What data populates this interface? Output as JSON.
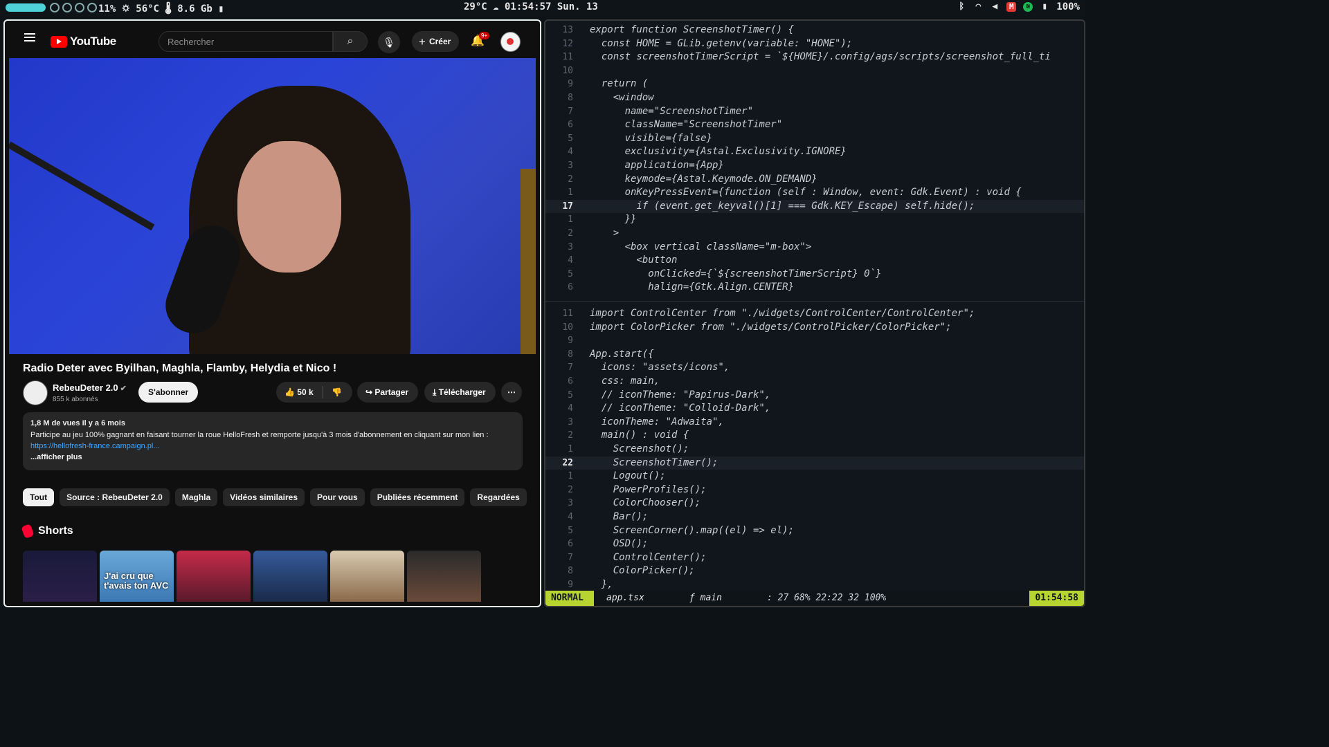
{
  "topbar": {
    "stats": "11% 🌣 56°C 🌡 8.6 Gb ▮",
    "weather_clock": "29°C ☁   01:54:57   Sun. 13",
    "battery": "100%",
    "icons": [
      "bluetooth-icon",
      "wifi-icon",
      "volume-icon",
      "mail-icon",
      "spotify-icon",
      "battery-icon"
    ]
  },
  "youtube": {
    "logo_text": "YouTube",
    "search_placeholder": "Rechercher",
    "create_label": "Créer",
    "notif_badge": "9+",
    "video_title": "Radio Deter avec Byilhan, Maghla, Flamby, Helydia et Nico !",
    "channel_name": "RebeuDeter 2.0",
    "subscribers": "855 k abonnés",
    "subscribe_label": "S'abonner",
    "likes": "50 k",
    "share_label": "Partager",
    "download_label": "Télécharger",
    "desc_meta": "1,8 M de vues  il y a 6 mois",
    "desc_text": "Participe au jeu 100% gagnant en faisant tourner la roue HelloFresh et remporte jusqu'à 3 mois d'abonnement en cliquant sur mon lien :",
    "desc_link": "https://hellofresh-france.campaign.pl...",
    "desc_more": "...afficher plus",
    "chips": [
      "Tout",
      "Source : RebeuDeter 2.0",
      "Maghla",
      "Vidéos similaires",
      "Pour vous",
      "Publiées récemment",
      "Regardées"
    ],
    "shorts_title": "Shorts",
    "short_caption": "J'ai cru que t'avais ton AVC"
  },
  "editor": {
    "top_lines": [
      {
        "n": "13",
        "t": "export function ScreenshotTimer() {"
      },
      {
        "n": "12",
        "t": "  const HOME = GLib.getenv(variable: \"HOME\");"
      },
      {
        "n": "11",
        "t": "  const screenshotTimerScript = `${HOME}/.config/ags/scripts/screenshot_full_ti"
      },
      {
        "n": "10",
        "t": ""
      },
      {
        "n": "9",
        "t": "  return ("
      },
      {
        "n": "8",
        "t": "    <window"
      },
      {
        "n": "7",
        "t": "      name=\"ScreenshotTimer\""
      },
      {
        "n": "6",
        "t": "      className=\"ScreenshotTimer\""
      },
      {
        "n": "5",
        "t": "      visible={false}"
      },
      {
        "n": "4",
        "t": "      exclusivity={Astal.Exclusivity.IGNORE}"
      },
      {
        "n": "3",
        "t": "      application={App}"
      },
      {
        "n": "2",
        "t": "      keymode={Astal.Keymode.ON_DEMAND}"
      },
      {
        "n": "1",
        "t": "      onKeyPressEvent={function (self : Window, event: Gdk.Event) : void {"
      },
      {
        "n": "17",
        "t": "        if (event.get_keyval()[1] === Gdk.KEY_Escape) self.hide();"
      },
      {
        "n": "1",
        "t": "      }}"
      },
      {
        "n": "2",
        "t": "    >"
      },
      {
        "n": "3",
        "t": "      <box vertical className=\"m-box\">"
      },
      {
        "n": "4",
        "t": "        <button"
      },
      {
        "n": "5",
        "t": "          onClicked={`${screenshotTimerScript} 0`}"
      },
      {
        "n": "6",
        "t": "          halign={Gtk.Align.CENTER}"
      }
    ],
    "bottom_lines": [
      {
        "n": "11",
        "t": "import ControlCenter from \"./widgets/ControlCenter/ControlCenter\";"
      },
      {
        "n": "10",
        "t": "import ColorPicker from \"./widgets/ControlPicker/ColorPicker\";"
      },
      {
        "n": "9",
        "t": ""
      },
      {
        "n": "8",
        "t": "App.start({"
      },
      {
        "n": "7",
        "t": "  icons: \"assets/icons\","
      },
      {
        "n": "6",
        "t": "  css: main,"
      },
      {
        "n": "5",
        "t": "  // iconTheme: \"Papirus-Dark\","
      },
      {
        "n": "4",
        "t": "  // iconTheme: \"Colloid-Dark\","
      },
      {
        "n": "3",
        "t": "  iconTheme: \"Adwaita\","
      },
      {
        "n": "2",
        "t": "  main() : void {"
      },
      {
        "n": "1",
        "t": "    Screenshot();"
      },
      {
        "n": "22",
        "t": "    ScreenshotTimer();"
      },
      {
        "n": "1",
        "t": "    Logout();"
      },
      {
        "n": "2",
        "t": "    PowerProfiles();"
      },
      {
        "n": "3",
        "t": "    ColorChooser();"
      },
      {
        "n": "4",
        "t": "    Bar();"
      },
      {
        "n": "5",
        "t": "    ScreenCorner().map((el) => el);"
      },
      {
        "n": "6",
        "t": "    OSD();"
      },
      {
        "n": "7",
        "t": "    ControlCenter();"
      },
      {
        "n": "8",
        "t": "    ColorPicker();"
      },
      {
        "n": "9",
        "t": "  },"
      }
    ],
    "status": {
      "mode": "NORMAL",
      "file": "app.tsx",
      "func": "ƒ main",
      "info": ":  27   68%   22:22   32   100%",
      "clock": "01:54:58"
    }
  }
}
